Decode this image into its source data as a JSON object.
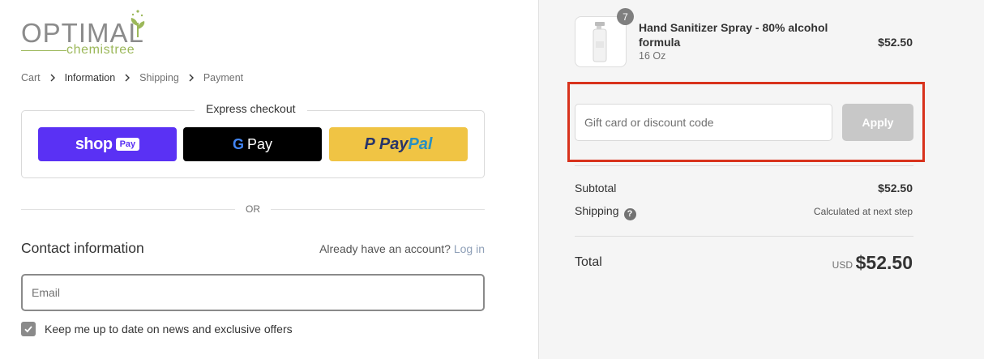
{
  "brand": {
    "logo_main": "OPTIMAL",
    "logo_sub": "chemistree",
    "colors": {
      "grey": "#8b8b8b",
      "green": "#9cb85a"
    }
  },
  "breadcrumb": {
    "items": [
      {
        "label": "Cart",
        "active": false
      },
      {
        "label": "Information",
        "active": true
      },
      {
        "label": "Shipping",
        "active": false
      },
      {
        "label": "Payment",
        "active": false
      }
    ]
  },
  "express": {
    "title": "Express checkout",
    "shop_pay": {
      "word": "shop",
      "pill": "Pay",
      "color": "#5a31f4"
    },
    "google_pay": {
      "g": "G",
      "word": "Pay",
      "color": "#000000"
    },
    "paypal": {
      "part1": "Pay",
      "part2": "Pal",
      "color": "#f0c444"
    }
  },
  "divider": {
    "or_text": "OR"
  },
  "contact": {
    "title": "Contact information",
    "account_prompt": "Already have an account?",
    "login_link": "Log in",
    "email_placeholder": "Email",
    "newsletter_label": "Keep me up to date on news and exclusive offers",
    "newsletter_checked": true
  },
  "order": {
    "product": {
      "name": "Hand Sanitizer Spray - 80% alcohol formula",
      "variant": "16 Oz",
      "price": "$52.50",
      "quantity": "7"
    },
    "discount": {
      "placeholder": "Gift card or discount code",
      "apply_label": "Apply",
      "highlight_color": "#d8321c"
    },
    "summary": {
      "subtotal_label": "Subtotal",
      "subtotal_value": "$52.50",
      "shipping_label": "Shipping",
      "shipping_value": "Calculated at next step",
      "total_label": "Total",
      "currency": "USD",
      "total_value": "$52.50"
    }
  }
}
